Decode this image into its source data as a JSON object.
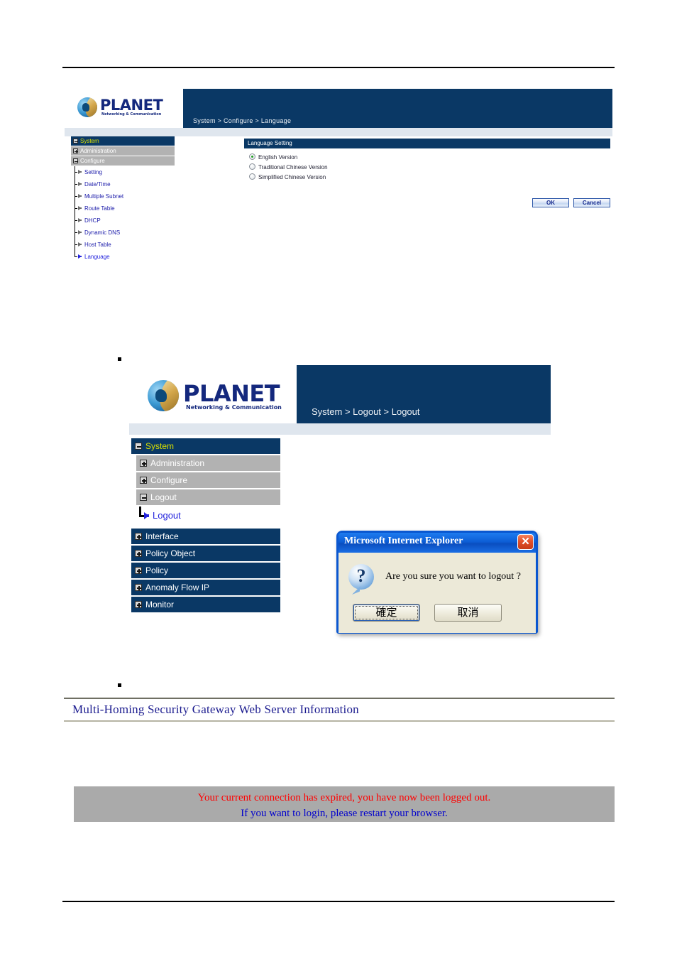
{
  "figure1": {
    "breadcrumb": "System > Configure > Language",
    "logo": {
      "word": "PLANET",
      "tagline": "Networking & Communication"
    },
    "sidebar": {
      "groups": [
        {
          "label": "System",
          "state": "expanded",
          "style": "navy"
        },
        {
          "label": "Administration",
          "state": "collapsed",
          "style": "grey"
        },
        {
          "label": "Configure",
          "state": "expanded",
          "style": "grey"
        }
      ],
      "leaves": [
        {
          "label": "Setting",
          "active": false
        },
        {
          "label": "Date/Time",
          "active": false
        },
        {
          "label": "Multiple Subnet",
          "active": false
        },
        {
          "label": "Route Table",
          "active": false
        },
        {
          "label": "DHCP",
          "active": false
        },
        {
          "label": "Dynamic DNS",
          "active": false
        },
        {
          "label": "Host Table",
          "active": false
        },
        {
          "label": "Language",
          "active": true
        }
      ]
    },
    "panel": {
      "title": "Language Setting",
      "options": [
        {
          "label": "English Version",
          "selected": true
        },
        {
          "label": "Traditional Chinese Version",
          "selected": false
        },
        {
          "label": "Simplified Chinese Version",
          "selected": false
        }
      ],
      "ok_label": "OK",
      "cancel_label": "Cancel"
    }
  },
  "figure2": {
    "breadcrumb": "System > Logout > Logout",
    "logo": {
      "word": "PLANET",
      "tagline": "Networking & Communication"
    },
    "sidebar": {
      "system_label": "System",
      "sub_items": [
        {
          "label": "Administration",
          "state": "collapsed"
        },
        {
          "label": "Configure",
          "state": "collapsed"
        },
        {
          "label": "Logout",
          "state": "expanded"
        }
      ],
      "leaf": {
        "label": "Logout"
      },
      "top_items": [
        {
          "label": "Interface"
        },
        {
          "label": "Policy Object"
        },
        {
          "label": "Policy"
        },
        {
          "label": "Anomaly Flow IP"
        },
        {
          "label": "Monitor"
        }
      ]
    },
    "dialog": {
      "title": "Microsoft Internet Explorer",
      "close_icon": "✕",
      "icon": "?",
      "message": "Are you sure you want to logout ?",
      "ok_label": "確定",
      "cancel_label": "取消"
    }
  },
  "figure3": {
    "title": "Multi-Homing Security Gateway Web Server Information",
    "line1": "Your current connection has expired, you have now been logged out.",
    "line2": "If you want to login, please restart your browser."
  },
  "colors": {
    "navy": "#0a3865",
    "grey_row": "#b2b2b2",
    "subbar": "#dfe6ee",
    "link_blue": "#2323dd",
    "yellow_text": "#d9e000",
    "error_red": "#ff0000",
    "info_blue": "#0000cd",
    "msgbox_grey": "#aaaaaa"
  }
}
